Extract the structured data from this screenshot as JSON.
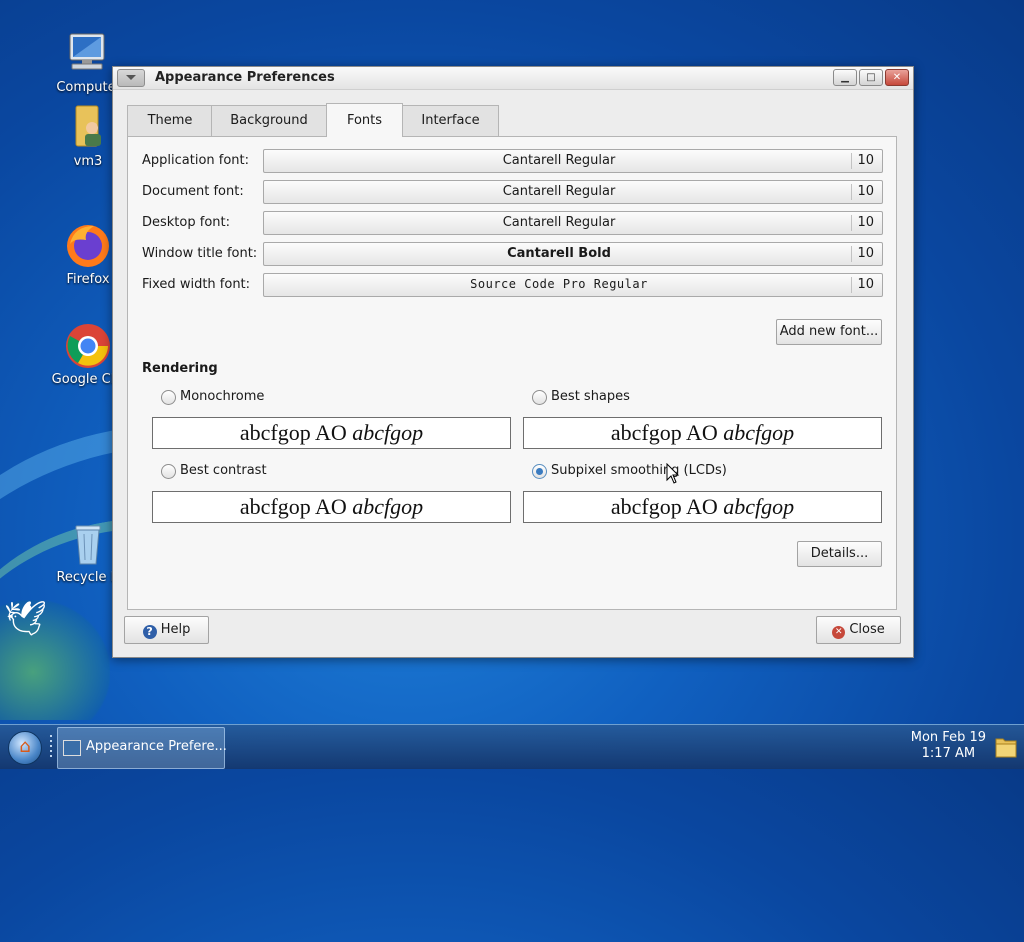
{
  "desktop": {
    "icons": [
      {
        "name": "computer",
        "label": "Compute"
      },
      {
        "name": "vm3",
        "label": "vm3"
      },
      {
        "name": "firefox",
        "label": "Firefox"
      },
      {
        "name": "chrome",
        "label": "Google Chr"
      },
      {
        "name": "recycle-bin",
        "label": "Recycle B"
      }
    ]
  },
  "window": {
    "title": "Appearance Preferences",
    "controls": {
      "minimize": "▁",
      "maximize": "□",
      "close": "✕"
    }
  },
  "tabs": [
    {
      "label": "Theme",
      "active": false
    },
    {
      "label": "Background",
      "active": false
    },
    {
      "label": "Fonts",
      "active": true
    },
    {
      "label": "Interface",
      "active": false
    }
  ],
  "fonts": [
    {
      "label": "Application font:",
      "font": "Cantarell Regular",
      "size": "10"
    },
    {
      "label": "Document font:",
      "font": "Cantarell Regular",
      "size": "10"
    },
    {
      "label": "Desktop font:",
      "font": "Cantarell Regular",
      "size": "10"
    },
    {
      "label": "Window title font:",
      "font": "Cantarell Bold",
      "size": "10"
    },
    {
      "label": "Fixed width font:",
      "font": "Source Code Pro Regular",
      "size": "10"
    }
  ],
  "add_font_label": "Add new font...",
  "rendering": {
    "title": "Rendering",
    "sample_text": "abcfgop AO ",
    "sample_italic": "abcfgop",
    "options": [
      {
        "label": "Monochrome",
        "selected": false
      },
      {
        "label": "Best shapes",
        "selected": false
      },
      {
        "label": "Best contrast",
        "selected": false
      },
      {
        "label": "Subpixel smoothing (LCDs)",
        "selected": true
      }
    ]
  },
  "details_label": "Details...",
  "help_label": "Help",
  "close_label": "Close",
  "taskbar": {
    "task_label": "Appearance Prefere...",
    "clock_date": "Mon Feb 19",
    "clock_time": "1:17 AM"
  },
  "colors": {
    "desktop": "#1060c0",
    "radio_selected": "#3a7bc0",
    "close_button": "#c6483a"
  }
}
